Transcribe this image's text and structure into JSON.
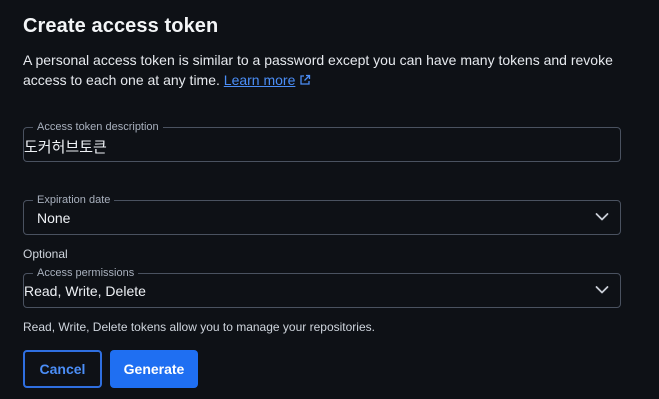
{
  "dialog": {
    "title": "Create access token",
    "description": "A personal access token is similar to a password except you can have many tokens and revoke access to each one at any time.",
    "learn_more_label": "Learn more"
  },
  "fields": {
    "description": {
      "legend": "Access token description",
      "value": "도커허브토큰"
    },
    "expiration": {
      "legend": "Expiration date",
      "value": "None"
    },
    "optional_label": "Optional",
    "permissions": {
      "legend": "Access permissions",
      "value": "Read, Write, Delete",
      "helper": "Read, Write, Delete tokens allow you to manage your repositories."
    }
  },
  "buttons": {
    "cancel_label": "Cancel",
    "generate_label": "Generate"
  },
  "colors": {
    "background": "#0e1116",
    "accent": "#1f6ff2",
    "link": "#4b8ef7",
    "border": "#4a5260"
  },
  "icons": {
    "external_link": "external-link-icon",
    "dropdown": "chevron-down-icon"
  }
}
